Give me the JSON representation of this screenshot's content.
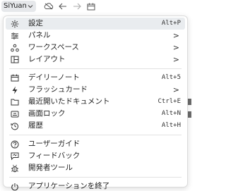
{
  "toolbar": {
    "workspace_name": "SiYuan",
    "icons": [
      "chevron-down-icon",
      "sync-icon",
      "back-icon",
      "forward-icon",
      "calendar-icon"
    ]
  },
  "menu": {
    "items": [
      {
        "label": "設定",
        "icon": "gear-icon",
        "shortcut": "Alt+P",
        "submenu": false,
        "active": true
      },
      {
        "label": "パネル",
        "icon": "panel-icon",
        "shortcut": "",
        "submenu": true
      },
      {
        "label": "ワークスペース",
        "icon": "workspace-icon",
        "shortcut": "",
        "submenu": true
      },
      {
        "label": "レイアウト",
        "icon": "layout-icon",
        "shortcut": "",
        "submenu": true
      },
      {
        "label": "デイリーノート",
        "icon": "calendar-icon",
        "shortcut": "Alt+5",
        "submenu": false
      },
      {
        "label": "フラッシュカード",
        "icon": "flash-icon",
        "shortcut": "",
        "submenu": true
      },
      {
        "label": "最近開いたドキュメント",
        "icon": "folder-icon",
        "shortcut": "Ctrl+E",
        "submenu": false
      },
      {
        "label": "画面ロック",
        "icon": "lock-icon",
        "shortcut": "Alt+N",
        "submenu": false
      },
      {
        "label": "履歴",
        "icon": "history-icon",
        "shortcut": "Alt+H",
        "submenu": false
      },
      {
        "label": "ユーザーガイド",
        "icon": "help-icon",
        "shortcut": "",
        "submenu": false
      },
      {
        "label": "フィードバック",
        "icon": "feedback-icon",
        "shortcut": "",
        "submenu": false
      },
      {
        "label": "開発者ツール",
        "icon": "bug-icon",
        "shortcut": "",
        "submenu": false
      },
      {
        "label": "アプリケーションを終了",
        "icon": "power-icon",
        "shortcut": "",
        "submenu": false
      }
    ],
    "submenu_arrow": ">"
  }
}
